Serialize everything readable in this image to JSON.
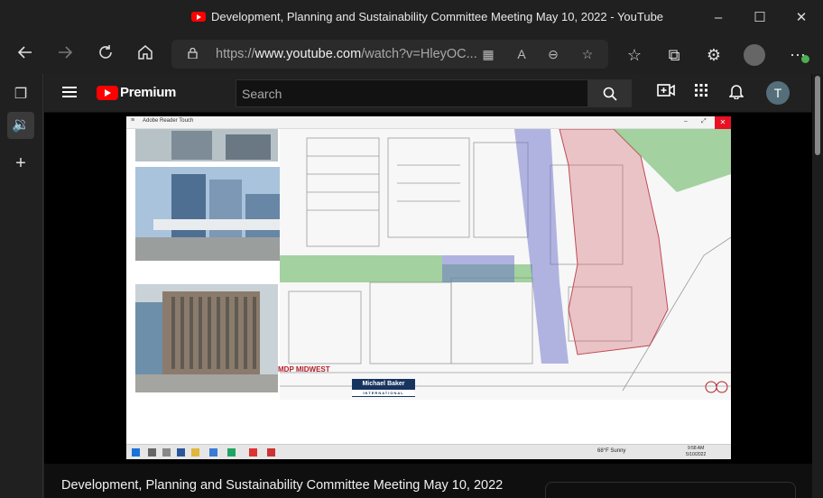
{
  "window": {
    "title": "Development, Planning and Sustainability Committee Meeting May 10, 2022 - YouTube",
    "minimize_glyph": "–",
    "maximize_glyph": "☐",
    "close_glyph": "✕"
  },
  "browser": {
    "url_prefix": "https://",
    "url_domain": "www.youtube.com",
    "url_path": "/watch?v=HleyOC...",
    "icons": [
      "back-icon",
      "forward-icon",
      "refresh-icon",
      "home-icon",
      "lock-icon",
      "apps-icon",
      "read-aloud-icon",
      "zoom-out-icon",
      "favorite-add-icon",
      "favorites-icon",
      "collections-icon",
      "extensions-icon",
      "profile-avatar",
      "more-icon"
    ]
  },
  "sidebar": {
    "icons": [
      "tab-actions-icon",
      "speaker-icon",
      "add-icon"
    ]
  },
  "youtube": {
    "brand": "Premium",
    "search_placeholder": "Search",
    "avatar_letter": "T",
    "video_title": "Development, Planning and Sustainability Committee Meeting May 10, 2022"
  },
  "video": {
    "reader_title": "Adobe Reader Touch",
    "close_glyph": "✕",
    "logo_midwest": "MDP MIDWEST",
    "logo_baker_line1": "Michael Baker",
    "logo_baker_line2": "INTERNATIONAL",
    "weather": "68°F Sunny",
    "clock_time": "9:58 AM",
    "clock_date": "5/10/2022"
  },
  "colors": {
    "chrome_bg": "#202020",
    "yt_red": "#ff0000",
    "plan_green": "#5fb25a",
    "plan_blue": "#6a6fc9",
    "plan_red": "#d2606b"
  }
}
